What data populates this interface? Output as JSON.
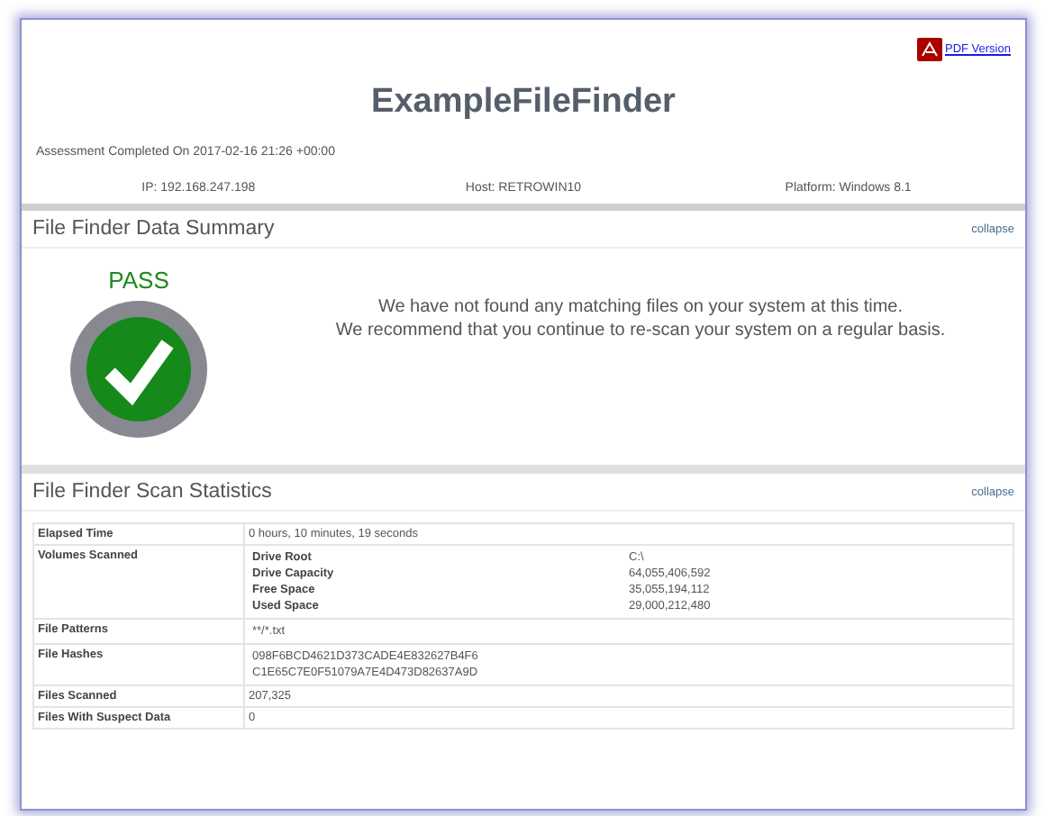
{
  "header": {
    "pdf_link": "PDF Version",
    "title": "ExampleFileFinder",
    "assessment": "Assessment Completed On 2017-02-16 21:26 +00:00",
    "info": [
      "IP: 192.168.247.198",
      "Host: RETROWIN10",
      "Platform: Windows 8.1"
    ]
  },
  "summary": {
    "title": "File Finder Data Summary",
    "collapse": "collapse",
    "status": "PASS",
    "messages": [
      "We have not found any matching files on your system at this time.",
      "We recommend that you continue to re-scan your system on a regular basis."
    ]
  },
  "statistics": {
    "title": "File Finder Scan Statistics",
    "collapse": "collapse",
    "rows": [
      {
        "kind": "text",
        "label": "Elapsed Time",
        "value": "0 hours, 10 minutes, 19 seconds"
      },
      {
        "kind": "pairs",
        "label": "Volumes Scanned",
        "pairs": [
          {
            "name": "Drive Root",
            "value": "C:\\"
          },
          {
            "name": "Drive Capacity",
            "value": "64,055,406,592"
          },
          {
            "name": "Free Space",
            "value": "35,055,194,112"
          },
          {
            "name": "Used Space",
            "value": "29,000,212,480"
          }
        ]
      },
      {
        "kind": "lines",
        "label": "File Patterns",
        "lines": [
          "**/*.txt"
        ]
      },
      {
        "kind": "lines",
        "label": "File Hashes",
        "lines": [
          "098F6BCD4621D373CADE4E832627B4F6",
          "C1E65C7E0F51079A7E4D473D82637A9D"
        ]
      },
      {
        "kind": "text",
        "label": "Files Scanned",
        "value": "207,325"
      },
      {
        "kind": "text",
        "label": "Files With Suspect Data",
        "value": "0"
      }
    ]
  }
}
